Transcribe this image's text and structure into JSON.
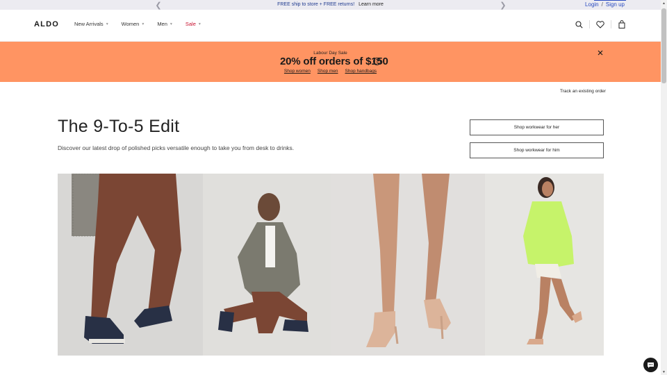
{
  "topbar": {
    "promo_free": "FREE ship to store + FREE returns!",
    "promo_learn": "Learn more",
    "login": "Login",
    "separator": "/",
    "signup": "Sign up"
  },
  "header": {
    "logo": "ALDO",
    "nav": [
      {
        "label": "New Arrivals"
      },
      {
        "label": "Women"
      },
      {
        "label": "Men"
      },
      {
        "label": "Sale"
      }
    ],
    "icons": [
      "search-icon",
      "heart-icon",
      "bag-icon"
    ]
  },
  "banner": {
    "eyebrow": "Labour Day Sale",
    "headline": "20% off orders of $150",
    "links": [
      "Shop women",
      "Shop men",
      "Shop handbags"
    ],
    "color": "#ff9462"
  },
  "main": {
    "track_order": "Track an existing order",
    "title": "The 9-To-5 Edit",
    "subtitle": "Discover our latest drop of polished picks versatile enough to take you from desk to drinks.",
    "buttons": {
      "her": "Shop workwear for her",
      "him": "Shop workwear for him"
    }
  },
  "colors": {
    "brand_text": "#1a1a1a",
    "sale": "#c8102e",
    "login_link": "#2a4bbf",
    "topbar_bg": "#ecebf1"
  }
}
